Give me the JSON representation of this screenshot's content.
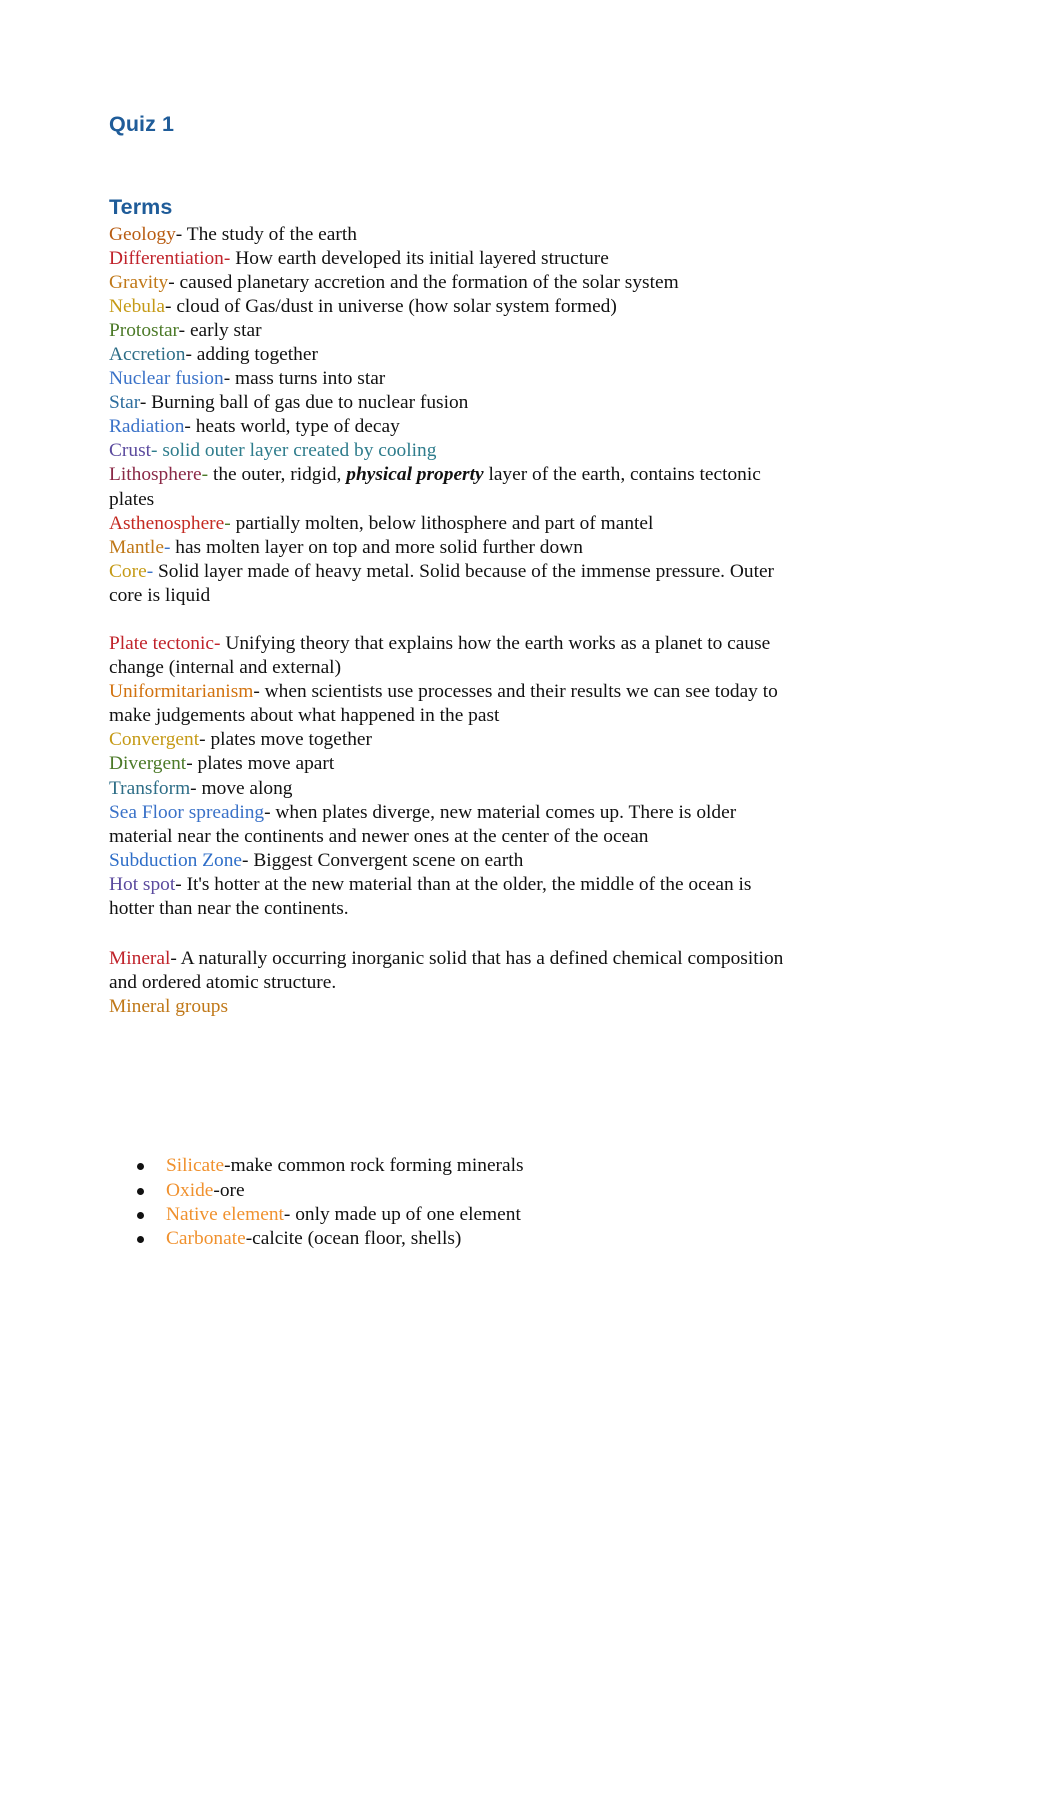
{
  "document": {
    "title": "Quiz 1",
    "section_heading": "Terms",
    "colors": {
      "heading_blue": "#1F5C99",
      "orange_dark": "#B85C12",
      "red": "#C0232B",
      "dark_red": "#B0202A",
      "gold": "#C08A12",
      "amber": "#C59A16",
      "green": "#4C7A28",
      "teal": "#2E6E87",
      "blue": "#3A72C8",
      "steel_blue": "#2E6E9E",
      "purple": "#5B4A9E",
      "maroon": "#8A2846",
      "crimson": "#C42A22",
      "orange_light": "#F0912E",
      "black": "#111111"
    },
    "terms_group_1": [
      {
        "term": "Geology",
        "term_color": "#B85C12",
        "dash": "- ",
        "dash_color": "#111111",
        "definition": "The study of the earth",
        "def_color": "#111111"
      },
      {
        "term": "Differentiation",
        "term_color": "#C0232B",
        "dash": "- ",
        "dash_color": "#C0232B",
        "definition": "How earth developed its initial layered structure",
        "def_color": "#111111"
      },
      {
        "term": "Gravity",
        "term_color": "#C07818",
        "dash": "- ",
        "dash_color": "#111111",
        "definition": "caused planetary accretion and the formation of the solar system",
        "def_color": "#111111"
      },
      {
        "term": "Nebula",
        "term_color": "#C59A16",
        "dash": "- ",
        "dash_color": "#111111",
        "definition": "cloud of Gas/dust in universe (how solar system formed)",
        "def_color": "#111111"
      },
      {
        "term": "Protostar",
        "term_color": "#4C7A28",
        "dash": "- ",
        "dash_color": "#111111",
        "definition": "early star",
        "def_color": "#111111"
      },
      {
        "term": "Accretion",
        "term_color": "#2E6E87",
        "dash": "- ",
        "dash_color": "#111111",
        "definition": "adding together",
        "def_color": "#111111"
      },
      {
        "term": "Nuclear fusion",
        "term_color": "#3A72C8",
        "dash": "- ",
        "dash_color": "#111111",
        "definition": "mass turns into star",
        "def_color": "#111111"
      },
      {
        "term": "Star",
        "term_color": "#2E6E9E",
        "dash": "- ",
        "dash_color": "#111111",
        "definition": "Burning ball of gas due to nuclear fusion",
        "def_color": "#111111"
      },
      {
        "term": "Radiation",
        "term_color": "#3A72C8",
        "dash": "- ",
        "dash_color": "#111111",
        "definition": "heats world, type of decay",
        "def_color": "#111111"
      },
      {
        "term": "Crust",
        "term_color": "#5B4A9E",
        "dash": "- ",
        "dash_color": "#2E7C8C",
        "definition": "solid outer layer created by cooling",
        "def_color": "#2E7C8C"
      }
    ],
    "lithosphere": {
      "term": "Lithosphere",
      "term_color": "#8A2846",
      "dash": "- ",
      "dash_color": "#4C7A28",
      "def_before": "the outer, ridgid, ",
      "emphasis": "physical property",
      "def_after": " layer of the earth, contains tectonic plates",
      "def_color": "#111111"
    },
    "terms_group_1b": [
      {
        "term": "Asthenosphere",
        "term_color": "#C42A22",
        "dash": "- ",
        "dash_color": "#4C7A28",
        "definition": "partially molten, below lithosphere and part of mantel",
        "def_color": "#111111"
      },
      {
        "term": "Mantle",
        "term_color": "#C07818",
        "dash": "- ",
        "dash_color": "#3A72C8",
        "definition": "has molten layer on top and more solid further down",
        "def_color": "#111111"
      },
      {
        "term": "Core",
        "term_color": "#C59A16",
        "dash": "- ",
        "dash_color": "#3A72C8",
        "definition": "Solid layer made of heavy metal. Solid because of the immense pressure. Outer core is liquid",
        "def_color": "#111111"
      }
    ],
    "terms_group_2": [
      {
        "term": "Plate tectonic",
        "term_color": "#C0232B",
        "dash": "- ",
        "dash_color": "#C0232B",
        "definition": "Unifying theory that explains how the earth works as a planet to cause change (internal and external)",
        "def_color": "#111111"
      },
      {
        "term": "Uniformitarianism",
        "term_color": "#D2720E",
        "dash": "- ",
        "dash_color": "#111111",
        "definition": "when scientists use processes and their results we can see today to make judgements about what happened in the past",
        "def_color": "#111111"
      },
      {
        "term": "Convergent",
        "term_color": "#C59A16",
        "dash": "- ",
        "dash_color": "#111111",
        "definition": "plates move together",
        "def_color": "#111111"
      },
      {
        "term": "Divergent",
        "term_color": "#4C7A28",
        "dash": "- ",
        "dash_color": "#111111",
        "definition": "plates move apart",
        "def_color": "#111111"
      },
      {
        "term": "Transform",
        "term_color": "#2E6E87",
        "dash": "- ",
        "dash_color": "#111111",
        "definition": "move along",
        "def_color": "#111111"
      },
      {
        "term": "Sea Floor spreading",
        "term_color": "#3A72C8",
        "dash": "- ",
        "dash_color": "#111111",
        "definition": "when plates diverge, new material comes up. There is older material near the continents and newer ones at the center of the ocean",
        "def_color": "#111111"
      },
      {
        "term": "Subduction Zone",
        "term_color": "#2E6EC8",
        "dash": "- ",
        "dash_color": "#111111",
        "definition": "Biggest Convergent scene on earth",
        "def_color": "#111111"
      },
      {
        "term": "Hot spot",
        "term_color": "#5B4A9E",
        "dash": "- ",
        "dash_color": "#111111",
        "definition": "It's hotter at the new material than at the older, the middle of the ocean is hotter than near the continents.",
        "def_color": "#111111"
      }
    ],
    "terms_group_3": [
      {
        "term": "Mineral",
        "term_color": "#C0232B",
        "dash": "- ",
        "dash_color": "#111111",
        "definition": "A naturally occurring inorganic solid that has a defined chemical composition and ordered atomic structure.",
        "def_color": "#111111"
      }
    ],
    "mineral_groups_label": {
      "text": "Mineral groups",
      "color": "#C07818"
    },
    "mineral_group_items": [
      {
        "term": "Silicate",
        "term_color": "#F0912E",
        "dash": "-",
        "dash_color": "#111111",
        "definition": "make common rock forming minerals",
        "def_color": "#111111"
      },
      {
        "term": "Oxide",
        "term_color": "#F0912E",
        "dash": "-",
        "dash_color": "#111111",
        "definition": "ore",
        "def_color": "#111111"
      },
      {
        "term": "Native element",
        "term_color": "#F0912E",
        "dash": "- ",
        "dash_color": "#111111",
        "definition": "only made up of one element",
        "def_color": "#111111"
      },
      {
        "term": "Carbonate",
        "term_color": "#F0912E",
        "dash": "-",
        "dash_color": "#111111",
        "definition": "calcite (ocean floor, shells)",
        "def_color": "#111111"
      }
    ]
  }
}
